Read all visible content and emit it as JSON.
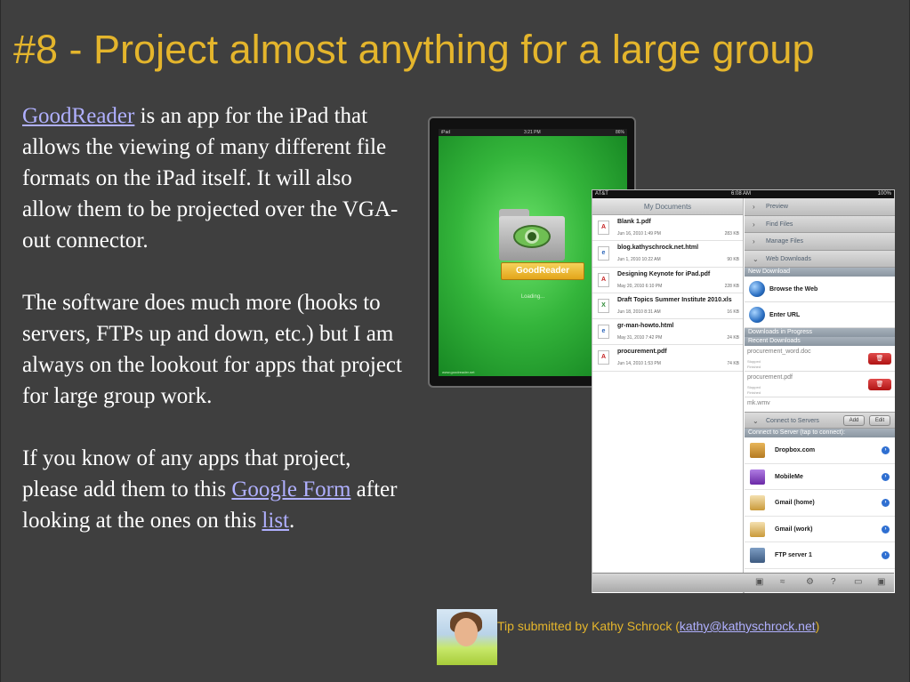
{
  "slide": {
    "title": "#8 - Project almost anything for a large group",
    "p1_link": "GoodReader",
    "p1_text": " is an app for the iPad that allows the viewing of many different file formats on the iPad itself. It will also allow them to be projected over the VGA-out connector.",
    "p2_text": "The software does much more (hooks to servers, FTPs up and down, etc.) but I am always on the lookout for apps that project for large group work.",
    "p3_text_a": "If you know of any apps that project, please add them to this ",
    "p3_link_form": "Google Form",
    "p3_text_b": " after looking at the ones on this ",
    "p3_link_list": "list",
    "p3_text_c": "."
  },
  "ipad_splash": {
    "status_left": "iPad",
    "status_time": "3:21 PM",
    "status_right": "86%",
    "app_label": "GoodReader",
    "loading": "Loading...",
    "footer": "www.goodreader.net"
  },
  "app": {
    "status": {
      "carrier": "AT&T",
      "time": "6:08 AM",
      "battery": "100%"
    },
    "left_title": "My Documents",
    "files": [
      {
        "name": "Blank 1.pdf",
        "date": "Jun 16, 2010 1:49 PM",
        "size": "283 KB",
        "type": "pdf",
        "icon": "pdf-file-icon"
      },
      {
        "name": "blog.kathyschrock.net.html",
        "date": "Jun 1, 2010 10:22 AM",
        "size": "90 KB",
        "type": "html",
        "icon": "html-file-icon"
      },
      {
        "name": "Designing Keynote for iPad.pdf",
        "date": "May 20, 2010 6:10 PM",
        "size": "228 KB",
        "type": "pdf",
        "icon": "pdf-file-icon"
      },
      {
        "name": "Draft Topics Summer Institute 2010.xls",
        "date": "Jun 18, 2010 8:31 AM",
        "size": "16 KB",
        "type": "xls",
        "icon": "xls-file-icon"
      },
      {
        "name": "gr-man-howto.html",
        "date": "May 31, 2010 7:42 PM",
        "size": "24 KB",
        "type": "html",
        "icon": "html-file-icon"
      },
      {
        "name": "procurement.pdf",
        "date": "Jun 14, 2010 1:53 PM",
        "size": "74 KB",
        "type": "pdf",
        "icon": "pdf-file-icon"
      }
    ],
    "nav": [
      "Preview",
      "Find Files",
      "Manage Files",
      "Web Downloads"
    ],
    "new_download_header": "New Download",
    "browse_web": "Browse the Web",
    "enter_url": "Enter URL",
    "downloads_progress_header": "Downloads in Progress",
    "recent_downloads_header": "Recent Downloads",
    "downloads": [
      {
        "name": "procurement_word.doc",
        "line1": "Stopped",
        "line2": "Finished"
      },
      {
        "name": "procurement.pdf",
        "line1": "Stopped",
        "line2": "Finished"
      },
      {
        "name": "mk.wmv"
      }
    ],
    "connect_label": "Connect to Servers",
    "add_label": "Add",
    "edit_label": "Edit",
    "connect_header": "Connect to Server (tap to connect):",
    "servers": [
      {
        "name": "Dropbox.com",
        "icon": "dropbox-icon"
      },
      {
        "name": "MobileMe",
        "icon": "mobileme-cloud-icon"
      },
      {
        "name": "Gmail (home)",
        "icon": "gmail-icon"
      },
      {
        "name": "Gmail (work)",
        "icon": "gmail-icon"
      },
      {
        "name": "FTP server 1",
        "icon": "ftp-server-icon"
      }
    ]
  },
  "footer": {
    "tip_prefix": "Tip submitted by Kathy Schrock (",
    "email": "kathy@kathyschrock.net",
    "tip_suffix": ")"
  },
  "colors": {
    "background": "#3f3f3f",
    "title": "#e4b52c",
    "body_text": "#ffffff",
    "link": "#b0b0ff"
  }
}
